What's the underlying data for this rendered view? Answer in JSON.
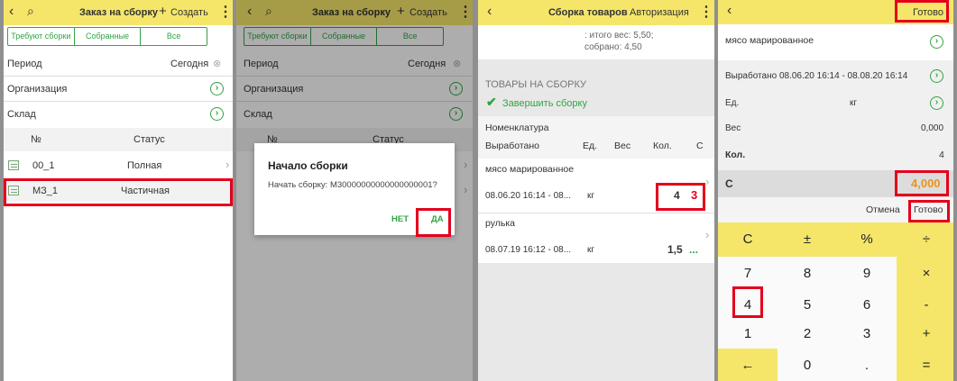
{
  "screen1": {
    "back": "‹",
    "title": "Заказ на сборку",
    "create": "Создать",
    "tabs": [
      "Требуют сборки",
      "Собранные",
      "Все"
    ],
    "period_label": "Период",
    "period_value": "Сегодня",
    "org_label": "Организация",
    "stock_label": "Склад",
    "col_num": "№",
    "col_status": "Статус",
    "rows": [
      {
        "num": "00_1",
        "status": "Полная"
      },
      {
        "num": "МЗ_1",
        "status": "Частичная"
      }
    ]
  },
  "screen2": {
    "title": "Заказ на сборку",
    "create": "Создать",
    "tabs": [
      "Требуют сборки",
      "Собранные",
      "Все"
    ],
    "period_label": "Период",
    "period_value": "Сегодня",
    "org_label": "Организация",
    "stock_label": "Склад",
    "col_num": "№",
    "col_status": "Статус",
    "dialog": {
      "title": "Начало сборки",
      "text": "Начать сборку: М30000000000000000001?",
      "no": "НЕТ",
      "yes": "ДА"
    }
  },
  "screen3": {
    "title": "Сборка товаров",
    "auth": "Авторизация",
    "weight_total": ": итого вес: 5,50;",
    "weight_collected": "собрано: 4,50",
    "section": "ТОВАРЫ НА СБОРКУ",
    "finish": "Завершить сборку",
    "col_nomen": "Номенклатура",
    "col_prod": "Выработано",
    "col_unit": "Ед.",
    "col_weight": "Вес",
    "col_qty": "Кол.",
    "col_c": "С",
    "items": [
      {
        "name": "мясо марированное",
        "date": "08.06.20 16:14 - 08...",
        "unit": "кг",
        "qty": "4",
        "c": "3"
      },
      {
        "name": "рулька",
        "date": "08.07.19 16:12 - 08...",
        "unit": "кг",
        "qty": "1,5",
        "c": "..."
      }
    ]
  },
  "screen4": {
    "done_top": "Готово",
    "product": "мясо марированное",
    "produced": "Выработано 08.06.20 16:14 - 08.08.20 16:14",
    "unit_label": "Ед.",
    "unit_value": "кг",
    "weight_label": "Вес",
    "weight_value": "0,000",
    "qty_label": "Кол.",
    "qty_value": "4",
    "c_label": "С",
    "c_value": "4,000",
    "cancel": "Отмена",
    "done": "Готово",
    "keys": [
      [
        "C",
        "±",
        "%",
        "÷"
      ],
      [
        "7",
        "8",
        "9",
        "×"
      ],
      [
        "4",
        "5",
        "6",
        "-"
      ],
      [
        "1",
        "2",
        "3",
        "+"
      ],
      [
        "←",
        "0",
        ".",
        "="
      ]
    ]
  },
  "colors": {
    "accent": "#f5e66a",
    "green": "#33a344",
    "highlight": "#e3001b",
    "orange": "#e8941f"
  }
}
